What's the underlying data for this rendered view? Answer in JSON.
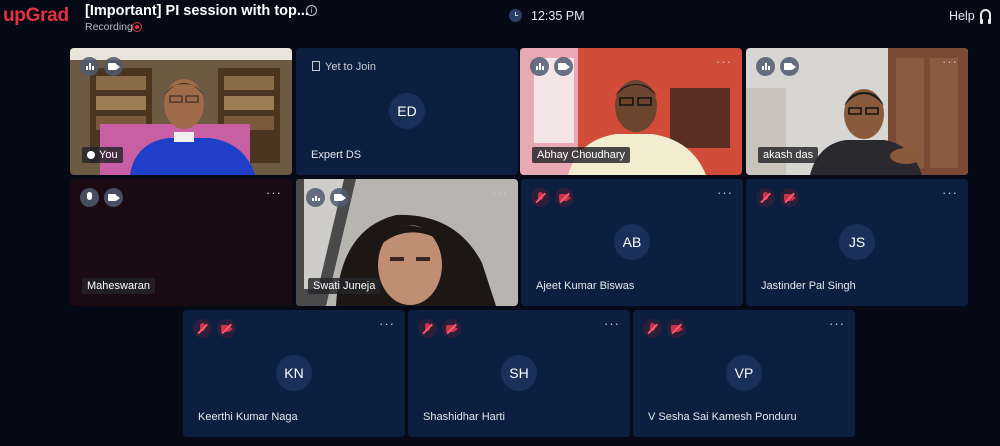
{
  "app": {
    "logo": "upGrad",
    "title": "[Important] PI session with top...",
    "recording_label": "Recording",
    "time": "12:35 PM",
    "help": "Help"
  },
  "participants": [
    {
      "name": "You",
      "initials": "",
      "video": true
    },
    {
      "name": "Expert DS",
      "initials": "ED",
      "status": "Yet to Join",
      "video": false
    },
    {
      "name": "Abhay Choudhary",
      "initials": "",
      "video": true
    },
    {
      "name": "akash das",
      "initials": "",
      "video": true
    },
    {
      "name": "Maheswaran",
      "initials": "",
      "video": false
    },
    {
      "name": "Swati Juneja",
      "initials": "",
      "video": true
    },
    {
      "name": "Ajeet Kumar Biswas",
      "initials": "AB",
      "video": false
    },
    {
      "name": "Jastinder Pal Singh",
      "initials": "JS",
      "video": false
    },
    {
      "name": "Keerthi Kumar Naga",
      "initials": "KN",
      "video": false
    },
    {
      "name": "Shashidhar Harti",
      "initials": "SH",
      "video": false
    },
    {
      "name": "V Sesha Sai Kamesh Ponduru",
      "initials": "VP",
      "video": false
    }
  ],
  "colors": {
    "brand": "#e8313f",
    "tile": "#0c1f40",
    "background": "#050a16"
  }
}
